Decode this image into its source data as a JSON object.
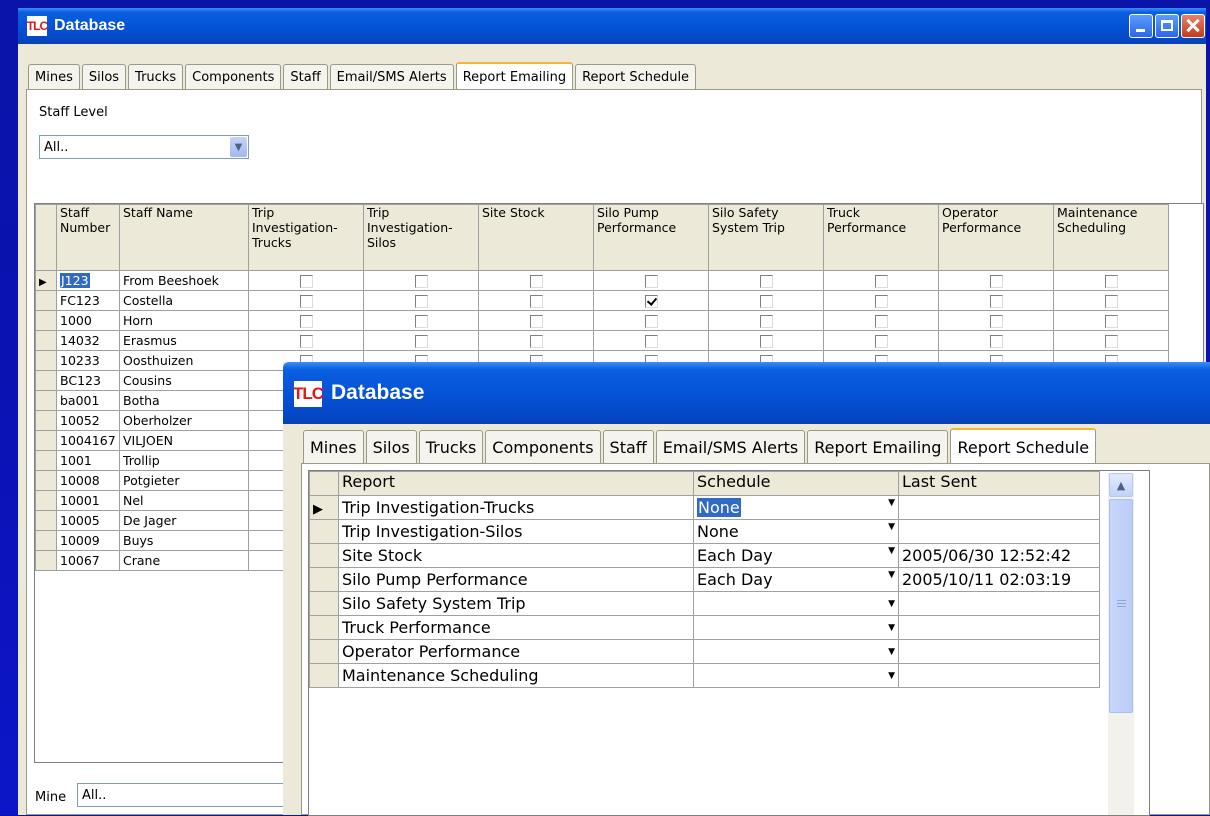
{
  "back_window": {
    "title": "Database",
    "logo": "TLC",
    "tabs": [
      "Mines",
      "Silos",
      "Trucks",
      "Components",
      "Staff",
      "Email/SMS Alerts",
      "Report Emailing",
      "Report Schedule"
    ],
    "active_tab": "Report Emailing",
    "staff_level_label": "Staff Level",
    "staff_level_value": "All..",
    "columns": {
      "staff_number": "Staff Number",
      "staff_name": "Staff Name",
      "trip_trucks": "Trip Investigation- Trucks",
      "trip_silos": "Trip Investigation- Silos",
      "site_stock": "Site Stock",
      "silo_pump": "Silo Pump Performance",
      "silo_safety": "Silo Safety System Trip",
      "truck_perf": "Truck Performance",
      "operator_perf": "Operator Performance",
      "maintenance": "Maintenance Scheduling"
    },
    "rows": [
      {
        "number": "J123",
        "name": "From Beeshoek",
        "checks": [
          false,
          false,
          false,
          false,
          false,
          false,
          false,
          false
        ]
      },
      {
        "number": "FC123",
        "name": "Costella",
        "checks": [
          false,
          false,
          false,
          true,
          false,
          false,
          false,
          false
        ]
      },
      {
        "number": "1000",
        "name": "Horn",
        "checks": [
          false,
          false,
          false,
          false,
          false,
          false,
          false,
          false
        ]
      },
      {
        "number": "14032",
        "name": "Erasmus",
        "checks": [
          false,
          false,
          false,
          false,
          false,
          false,
          false,
          false
        ]
      },
      {
        "number": "10233",
        "name": "Oosthuizen",
        "checks": [
          false,
          false,
          false,
          false,
          false,
          false,
          false,
          false
        ]
      },
      {
        "number": "BC123",
        "name": "Cousins",
        "checks": [
          false,
          false,
          false,
          false,
          false,
          false,
          false,
          false
        ]
      },
      {
        "number": "ba001",
        "name": "Botha",
        "checks": [
          false,
          false,
          false,
          false,
          false,
          false,
          false,
          false
        ]
      },
      {
        "number": "10052",
        "name": "Oberholzer",
        "checks": [
          false,
          false,
          false,
          false,
          false,
          false,
          false,
          false
        ]
      },
      {
        "number": "1004167",
        "name": "VILJOEN",
        "checks": [
          false,
          false,
          false,
          false,
          false,
          false,
          false,
          false
        ]
      },
      {
        "number": "1001",
        "name": "Trollip",
        "checks": [
          false,
          false,
          false,
          false,
          false,
          false,
          false,
          false
        ]
      },
      {
        "number": "10008",
        "name": "Potgieter",
        "checks": [
          false,
          false,
          false,
          false,
          false,
          false,
          false,
          false
        ]
      },
      {
        "number": "10001",
        "name": "Nel",
        "checks": [
          false,
          false,
          false,
          false,
          false,
          false,
          false,
          false
        ]
      },
      {
        "number": "10005",
        "name": "De Jager",
        "checks": [
          false,
          false,
          false,
          false,
          false,
          false,
          false,
          false
        ]
      },
      {
        "number": "10009",
        "name": "Buys",
        "checks": [
          false,
          false,
          false,
          false,
          false,
          false,
          false,
          false
        ]
      },
      {
        "number": "10067",
        "name": "Crane",
        "checks": [
          false,
          false,
          false,
          false,
          false,
          false,
          false,
          false
        ]
      }
    ],
    "mine_label": "Mine",
    "mine_value": "All.."
  },
  "front_window": {
    "title": "Database",
    "logo": "TLC",
    "tabs": [
      "Mines",
      "Silos",
      "Trucks",
      "Components",
      "Staff",
      "Email/SMS Alerts",
      "Report Emailing",
      "Report Schedule"
    ],
    "active_tab": "Report Schedule",
    "columns": {
      "report": "Report",
      "schedule": "Schedule",
      "last_sent": "Last Sent"
    },
    "rows": [
      {
        "report": "Trip Investigation-Trucks",
        "schedule": "None",
        "last_sent": ""
      },
      {
        "report": "Trip Investigation-Silos",
        "schedule": "None",
        "last_sent": ""
      },
      {
        "report": "Site Stock",
        "schedule": "Each Day",
        "last_sent": "2005/06/30 12:52:42"
      },
      {
        "report": "Silo Pump Performance",
        "schedule": "Each Day",
        "last_sent": "2005/10/11 02:03:19"
      },
      {
        "report": "Silo Safety System Trip",
        "schedule": "",
        "last_sent": ""
      },
      {
        "report": "Truck Performance",
        "schedule": "",
        "last_sent": ""
      },
      {
        "report": "Operator Performance",
        "schedule": "",
        "last_sent": ""
      },
      {
        "report": "Maintenance Scheduling",
        "schedule": "",
        "last_sent": ""
      }
    ]
  },
  "icons": {
    "row_pointer": "triangle-right-icon",
    "dropdown": "chevron-down-icon",
    "minimize": "minimize-icon",
    "maximize": "maximize-icon",
    "close": "close-icon",
    "scroll_up": "chevron-up-icon"
  },
  "colors": {
    "desktop": "#0a12b0",
    "titlebar": "#0553d8",
    "selection": "#316ac5",
    "active_tab_accent": "#f6b43c"
  }
}
